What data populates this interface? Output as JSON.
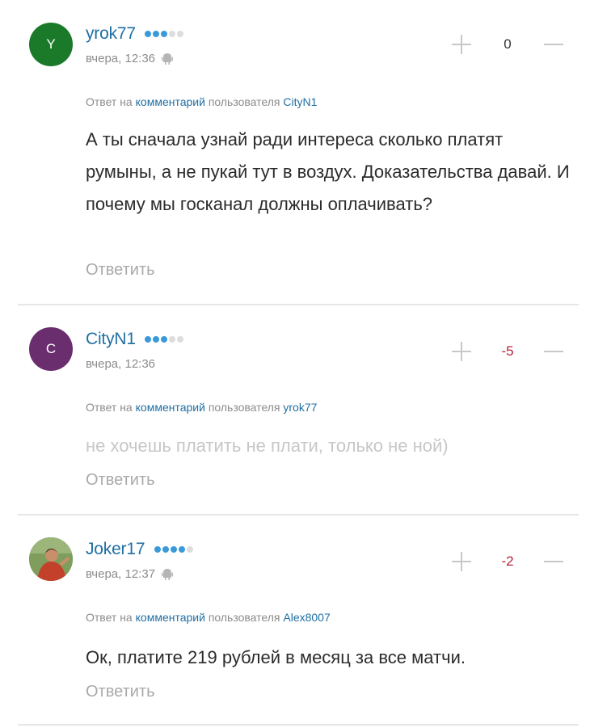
{
  "comments": [
    {
      "avatar_letter": "Y",
      "avatar_color": "#1a7a2a",
      "username": "yrok77",
      "rating_dots": [
        true,
        true,
        true,
        false,
        false
      ],
      "time": "вчера, 12:36",
      "platform_icon": "android-icon",
      "score": "0",
      "reply_prefix": "Ответ на",
      "reply_link": "комментарий",
      "reply_middle": "пользователя",
      "reply_user": "CityN1",
      "text": "А ты сначала узнай ради интереса сколько платят румыны, а не пукай тут в воздух. Доказательства давай. И почему мы госканал должны оплачивать?",
      "answer": "Ответить"
    },
    {
      "avatar_letter": "C",
      "avatar_color": "#6a2e6f",
      "username": "CityN1",
      "rating_dots": [
        true,
        true,
        true,
        false,
        false
      ],
      "time": "вчера, 12:36",
      "score": "-5",
      "reply_prefix": "Ответ на",
      "reply_link": "комментарий",
      "reply_middle": "пользователя",
      "reply_user": "yrok77",
      "text": "не хочешь платить не плати, только не ной)",
      "answer": "Ответить"
    },
    {
      "avatar_letter": "",
      "avatar_color": "#8aa36a",
      "username": "Joker17",
      "rating_dots": [
        true,
        true,
        true,
        true,
        false
      ],
      "time": "вчера, 12:37",
      "platform_icon": "android-icon",
      "score": "-2",
      "reply_prefix": "Ответ на",
      "reply_link": "комментарий",
      "reply_middle": "пользователя",
      "reply_user": "Alex8007",
      "text": "Ок, платите 219 рублей в месяц за все матчи.",
      "answer": "Ответить"
    }
  ]
}
